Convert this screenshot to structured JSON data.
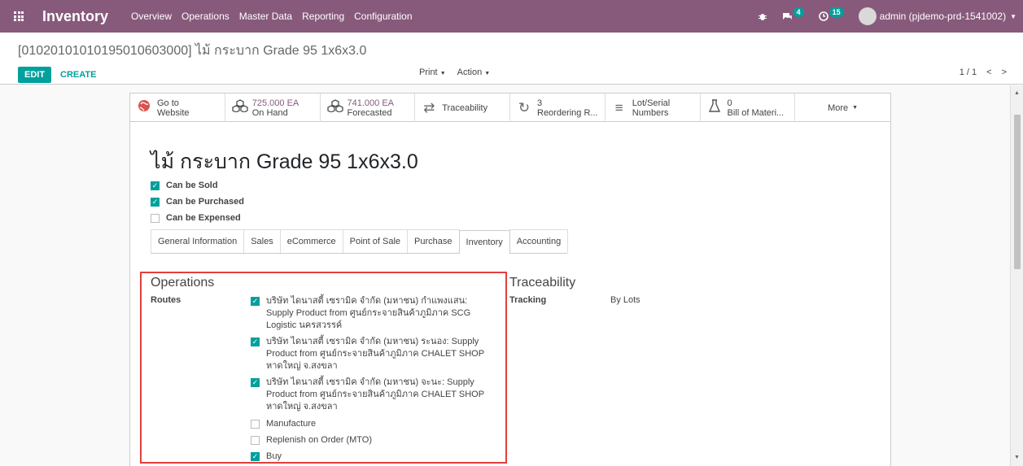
{
  "navbar": {
    "app_name": "Inventory",
    "menu": [
      "Overview",
      "Operations",
      "Master Data",
      "Reporting",
      "Configuration"
    ],
    "messages_count": "4",
    "activities_count": "15",
    "user": "admin (pjdemo-prd-1541002)"
  },
  "control": {
    "breadcrumb": "[01020101010195010603000] ไม้ กระบาก Grade 95 1x6x3.0",
    "edit_label": "EDIT",
    "create_label": "CREATE",
    "print_label": "Print",
    "action_label": "Action",
    "pager": "1 / 1"
  },
  "stat_buttons": [
    {
      "line1": "Go to",
      "line2": "Website",
      "icon": "globe-icon"
    },
    {
      "line1": "725.000 EA",
      "line2": "On Hand",
      "icon": "cubes-icon"
    },
    {
      "line1": "741.000 EA",
      "line2": "Forecasted",
      "icon": "cubes-icon"
    },
    {
      "line1": "Traceability",
      "line2": "",
      "icon": "exchange-icon"
    },
    {
      "line1": "3",
      "line2": "Reordering R...",
      "icon": "refresh-icon"
    },
    {
      "line1": "Lot/Serial",
      "line2": "Numbers",
      "icon": "bars-icon"
    },
    {
      "line1": "0",
      "line2": "Bill of Materi...",
      "icon": "flask-icon"
    },
    {
      "line1": "More",
      "line2": "",
      "icon": "caret-down-icon"
    }
  ],
  "product": {
    "name": "ไม้ กระบาก Grade 95 1x6x3.0",
    "can_be_sold": "Can be Sold",
    "can_be_purchased": "Can be Purchased",
    "can_be_expensed": "Can be Expensed"
  },
  "tabs": [
    "General Information",
    "Sales",
    "eCommerce",
    "Point of Sale",
    "Purchase",
    "Inventory",
    "Accounting"
  ],
  "operations": {
    "title": "Operations",
    "routes_label": "Routes",
    "routes": [
      {
        "text": "บริษัท ไดนาสตี้ เซรามิค จำกัด (มหาชน) กำแพงแสน: Supply Product from ศูนย์กระจายสินค้าภูมิภาค SCG Logistic นครสวรรค์",
        "checked": true
      },
      {
        "text": "บริษัท ไดนาสตี้ เซรามิค จำกัด (มหาชน) ระนอง: Supply Product from ศูนย์กระจายสินค้าภูมิภาค CHALET SHOP หาดใหญ่ จ.สงขลา",
        "checked": true
      },
      {
        "text": "บริษัท ไดนาสตี้ เซรามิค จำกัด (มหาชน) จะนะ: Supply Product from ศูนย์กระจายสินค้าภูมิภาค CHALET SHOP หาดใหญ่ จ.สงขลา",
        "checked": true
      },
      {
        "text": "Manufacture",
        "checked": false
      },
      {
        "text": "Replenish on Order (MTO)",
        "checked": false
      },
      {
        "text": "Buy",
        "checked": true
      }
    ]
  },
  "traceability": {
    "title": "Traceability",
    "tracking_label": "Tracking",
    "tracking_value": "By Lots"
  }
}
